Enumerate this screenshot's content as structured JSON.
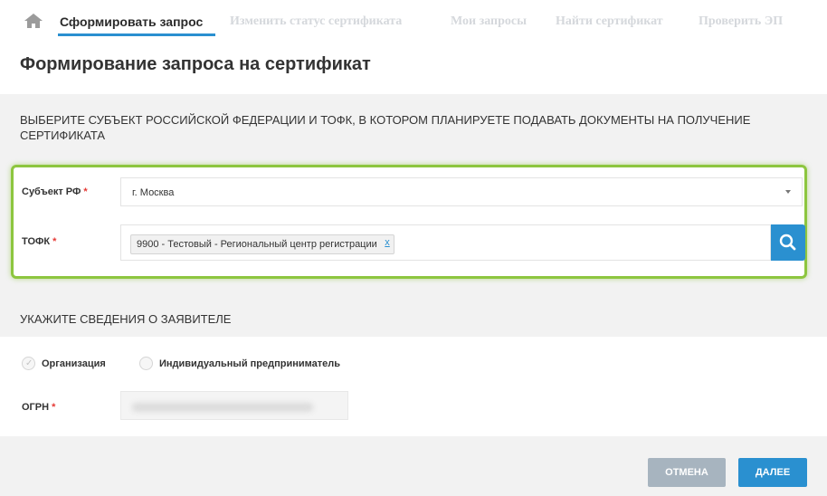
{
  "nav": {
    "tabs": [
      {
        "label": "Сформировать запрос",
        "active": true
      },
      {
        "label": "Изменить статус сертификата",
        "active": false
      },
      {
        "label": "Мои запросы",
        "active": false
      },
      {
        "label": "Найти сертификат",
        "active": false
      },
      {
        "label": "Проверить ЭП",
        "active": false
      }
    ],
    "home_icon": "home-icon",
    "active_color": "#2a90d0"
  },
  "page": {
    "title": "Формирование запроса на сертификат"
  },
  "region_section": {
    "heading": "ВЫБЕРИТЕ СУБЪЕКТ РОССИЙСКОЙ ФЕДЕРАЦИИ И ТОФК, В КОТОРОМ ПЛАНИРУЕТЕ ПОДАВАТЬ ДОКУМЕНТЫ НА ПОЛУЧЕНИЕ СЕРТИФИКАТА",
    "subject_label": "Субъект РФ",
    "subject_value": "г. Москва",
    "tofk_label": "ТОФК",
    "tofk_tag": "9900 - Тестовый - Региональный центр регистрации",
    "tofk_tag_remove": "x",
    "required_mark": "*",
    "highlight_color": "#8dc63f"
  },
  "applicant_section": {
    "heading": "УКАЖИТЕ СВЕДЕНИЯ О ЗАЯВИТЕЛЕ",
    "radio_org": "Организация",
    "radio_ip": "Индивидуальный предприниматель",
    "ogrn_label": "ОГРН"
  },
  "actions": {
    "cancel": "ОТМЕНА",
    "next": "ДАЛЕЕ",
    "cancel_color": "#a7b4bf",
    "next_color": "#2a90d0"
  }
}
